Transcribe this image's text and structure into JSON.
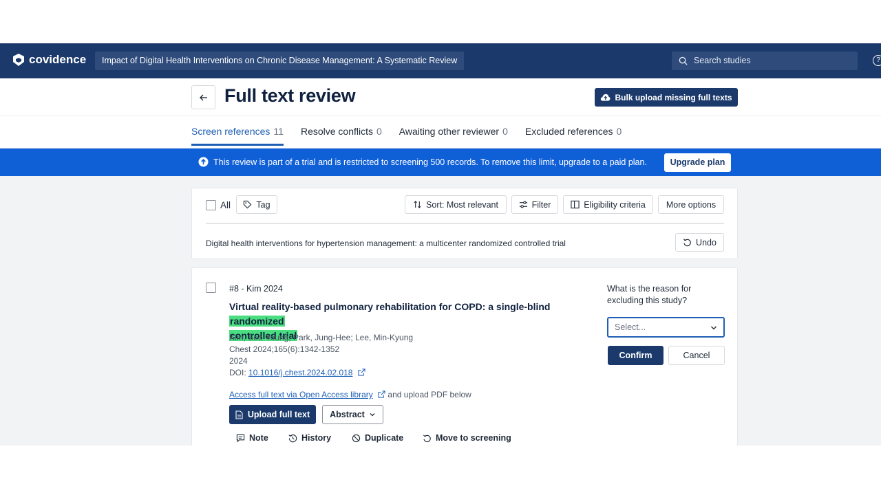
{
  "app": {
    "logo_text": "covidence",
    "review_title": "Impact of Digital Health Interventions on Chronic Disease Management: A Systematic Review",
    "search_placeholder": "Search studies",
    "help_glyph": "?"
  },
  "header": {
    "title": "Full text review",
    "bulk_upload_label": "Bulk upload missing full texts"
  },
  "tabs": [
    {
      "label": "Screen references",
      "count": "11",
      "active": true
    },
    {
      "label": "Resolve conflicts",
      "count": "0",
      "active": false
    },
    {
      "label": "Awaiting other reviewer",
      "count": "0",
      "active": false
    },
    {
      "label": "Excluded references",
      "count": "0",
      "active": false
    }
  ],
  "banner": {
    "text": "This review is part of a trial and is restricted to screening 500 records. To remove this limit, upgrade to a paid plan.",
    "button_label": "Upgrade plan"
  },
  "toolbar": {
    "all_label": "All",
    "tag_label": "Tag",
    "sort_label": "Sort: Most relevant",
    "filter_label": "Filter",
    "eligibility_label": "Eligibility criteria",
    "more_label": "More options",
    "undo_text": "Digital health interventions for hypertension management: a multicenter randomized controlled trial",
    "undo_label": "Undo"
  },
  "study": {
    "id_line": "#8 - Kim 2024",
    "title_before": "Virtual reality-based pulmonary rehabilitation for COPD: a single-blind ",
    "title_highlight_1": "randomized",
    "title_highlight_2": "controlled trial",
    "authors": "Kim, Soo-Young; Park, Jung-Hee; Lee, Min-Kyung",
    "journal": "Chest 2024;165(6):1342-1352",
    "year": "2024",
    "doi_label": "DOI: ",
    "doi": "10.1016/j.chest.2024.02.018",
    "access_link": "Access full text via Open Access library",
    "access_suffix": " and upload PDF below",
    "upload_label": "Upload full text",
    "abstract_label": "Abstract",
    "actions": {
      "note": "Note",
      "history": "History",
      "duplicate": "Duplicate",
      "move": "Move to screening"
    },
    "reason_label": "What is the reason for excluding this study?",
    "select_placeholder": "Select...",
    "confirm_label": "Confirm",
    "cancel_label": "Cancel"
  },
  "colors": {
    "nav_bg": "#1b3a6b",
    "banner_bg": "#0f5fd6",
    "accent": "#1d5fb5",
    "highlight": "#4ade80"
  }
}
